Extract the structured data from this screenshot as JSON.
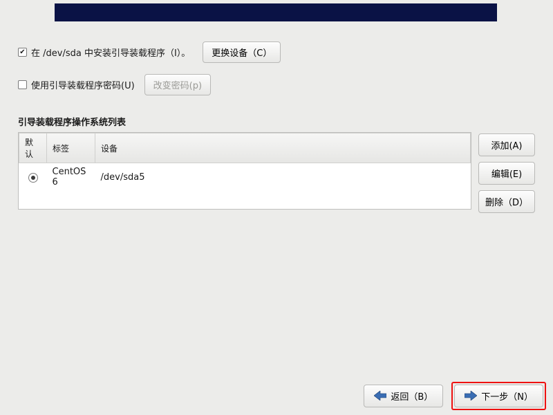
{
  "install_boot": {
    "checked": true,
    "label": "在 /dev/sda 中安装引导装载程序（I）。",
    "change_device_btn": "更换设备（C）"
  },
  "use_password": {
    "checked": false,
    "label": "使用引导装载程序密码(U)",
    "change_password_btn": "改变密码(p)"
  },
  "os_list": {
    "title": "引导装载程序操作系统列表",
    "headers": {
      "default": "默认",
      "label": "标签",
      "device": "设备"
    },
    "rows": [
      {
        "default": true,
        "label": "CentOS 6",
        "device": "/dev/sda5"
      }
    ]
  },
  "side_buttons": {
    "add": "添加(A)",
    "edit": "编辑(E)",
    "delete": "删除（D）"
  },
  "footer": {
    "back": "返回（B）",
    "next": "下一步（N）"
  }
}
